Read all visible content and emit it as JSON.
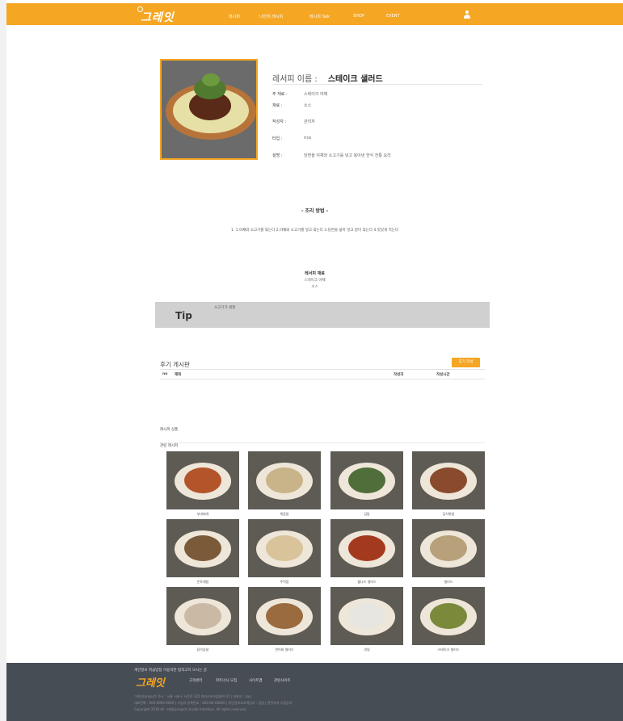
{
  "header": {
    "logo": "그레잇",
    "nav": [
      "레시피",
      "나만의 레시피",
      "레시피 Talk",
      "SHOP",
      "EVENT"
    ]
  },
  "recipe": {
    "title_label": "레서피 이름 :",
    "title_value": "스테이크 샐러드",
    "fields": [
      {
        "label": "주 재료 :",
        "value": "스테이크 야채"
      },
      {
        "label": "재료 :",
        "value": "소스"
      },
      {
        "label": "작성자 :",
        "value": "관리자"
      },
      {
        "label": "타입 :",
        "value": "rice"
      },
      {
        "label": "설명 :",
        "value": "당면을 야채와 소고기를 넣고 볶아낸 한식 전통 요리"
      }
    ]
  },
  "cooking": {
    "title": "- 조리 방법 -",
    "steps": "1. 1.야채와 소고기를 볶는다 2.야채와 소고기를 넣고 볶는다 3.당면을 삶아 넣고 같이 볶는다 4.맛있게 먹는다"
  },
  "ingredients": {
    "title": "레서피 재료",
    "items": [
      "스테이크 야채",
      "소스"
    ]
  },
  "tip": {
    "label": "Tip",
    "text": "소고기가 생명"
  },
  "reviews": {
    "title": "후기 게시판",
    "write_button": "후기 작성",
    "columns": [
      "no",
      "제목",
      "작성자",
      "작성시간"
    ]
  },
  "related": {
    "product_label": "레시피 상품",
    "recipes_label": "관련 레시피",
    "items": [
      {
        "name": "부대찌개",
        "color": "#b3542a"
      },
      {
        "name": "볶음밥",
        "color": "#c9b48a"
      },
      {
        "name": "김밥",
        "color": "#4f6e3a"
      },
      {
        "name": "김치볶밥",
        "color": "#8a4a2e"
      },
      {
        "name": "돈토채밥",
        "color": "#7b5a3a"
      },
      {
        "name": "주먹밥",
        "color": "#d8c39a"
      },
      {
        "name": "월나즈 샐러드",
        "color": "#a33a1e"
      },
      {
        "name": "샐러드",
        "color": "#b7a07a"
      },
      {
        "name": "닭가슴살",
        "color": "#c9b9a5"
      },
      {
        "name": "연어회 샐러드",
        "color": "#9a6b3f"
      },
      {
        "name": "과일",
        "color": "#e8e6e0"
      },
      {
        "name": "스테이크 샐러드",
        "color": "#7a8a3a"
      }
    ]
  },
  "footer": {
    "links": "개인정보 취급방침  이용약관  법적고지  모시는 글",
    "logo": "그레잇",
    "menu": [
      "고객센터",
      "파트너사 모집",
      "사이트맵",
      "관련사이트"
    ],
    "line1": "그레잇(project) 주소 : 서울 서초구 서운로 335 여자스포츠플래이 07 | 대표자 : aaa",
    "line2": "대표전화 : 000-0000-0000 | 사업자 등록번호 : 000-00-00000 | 개인정보보호책임자 : 임원 | 관련자의 가입공지",
    "line3": "Copyright 2018 All 그레잇(project) Inside Interface. All rights reserved."
  }
}
